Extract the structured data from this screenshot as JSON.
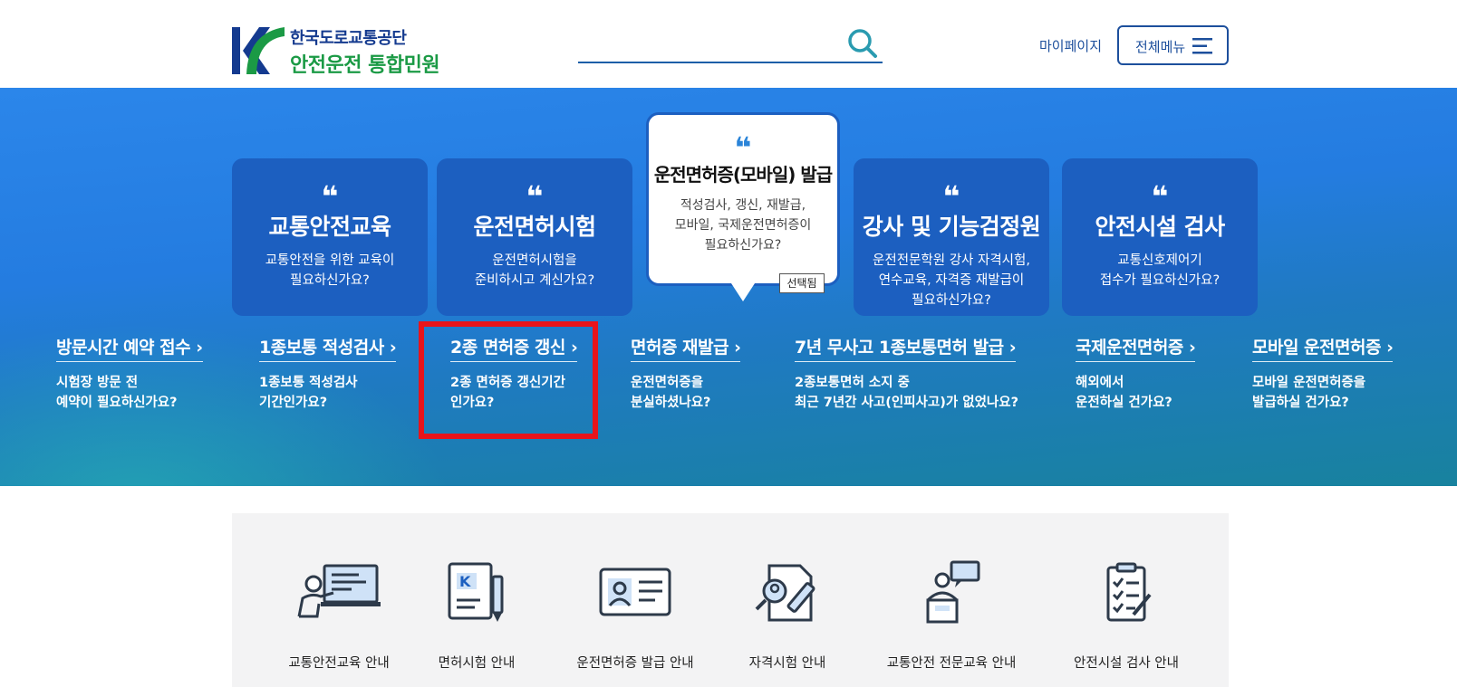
{
  "header": {
    "logo_line1": "한국도로교통공단",
    "logo_line2": "안전운전 통합민원",
    "search_placeholder": "",
    "mypage_label": "마이페이지",
    "allmenu_label": "전체메뉴"
  },
  "hero": {
    "cards": [
      {
        "title": "교통안전교육",
        "desc": "교통안전을 위한 교육이\n필요하신가요?"
      },
      {
        "title": "운전면허시험",
        "desc": "운전면허시험을\n준비하시고 계신가요?"
      },
      {
        "title": "운전면허증(모바일) 발급",
        "desc": "적성검사, 갱신, 재발급,\n모바일, 국제운전면허증이\n필요하신가요?",
        "badge": "선택됨",
        "selected": true
      },
      {
        "title": "강사 및 기능검정원",
        "desc": "운전전문학원 강사 자격시험,\n연수교육, 자격증 재발급이\n필요하신가요?"
      },
      {
        "title": "안전시설 검사",
        "desc": "교통신호제어기\n접수가 필요하신가요?"
      }
    ],
    "quick_links": [
      {
        "title": "방문시간 예약 접수",
        "desc": "시험장 방문 전\n예약이 필요하신가요?"
      },
      {
        "title": "1종보통 적성검사",
        "desc": "1종보통 적성검사\n기간인가요?"
      },
      {
        "title": "2종 면허증 갱신",
        "desc": "2종 면허증 갱신기간\n인가요?",
        "highlighted": true
      },
      {
        "title": "면허증 재발급",
        "desc": "운전면허증을\n분실하셨나요?"
      },
      {
        "title": "7년 무사고 1종보통면허 발급",
        "desc": "2종보통면허 소지 중\n최근 7년간 사고(인피사고)가 없었나요?"
      },
      {
        "title": "국제운전면허증",
        "desc": "해외에서\n운전하실 건가요?"
      },
      {
        "title": "모바일 운전면허증",
        "desc": "모바일 운전면허증을\n발급하실 건가요?"
      }
    ],
    "quote_mark": "❝",
    "arrow": "›"
  },
  "services": [
    {
      "label": "교통안전교육 안내",
      "icon": "presentation-icon"
    },
    {
      "label": "면허시험 안내",
      "icon": "license-exam-icon"
    },
    {
      "label": "운전면허증 발급 안내",
      "icon": "id-card-icon"
    },
    {
      "label": "자격시험 안내",
      "icon": "qualification-exam-icon"
    },
    {
      "label": "교통안전 전문교육 안내",
      "icon": "lecturer-icon"
    },
    {
      "label": "안전시설 검사 안내",
      "icon": "checklist-icon"
    }
  ],
  "colors": {
    "brand_blue": "#143a8f",
    "brand_green": "#1b9a45",
    "card_blue": "#1c5fc0",
    "highlight_red": "#e8141b"
  }
}
